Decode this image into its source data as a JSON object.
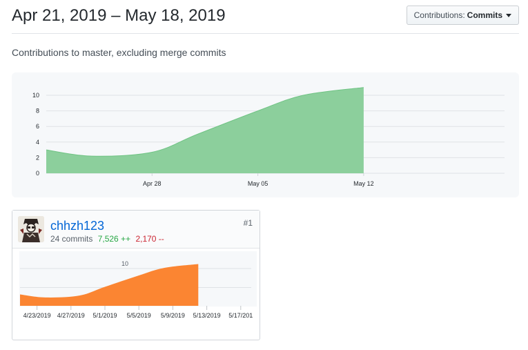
{
  "header": {
    "date_range": "Apr 21, 2019 – May 18, 2019",
    "contributions_select": {
      "label": "Contributions:",
      "value": "Commits"
    }
  },
  "subtitle": "Contributions to master, excluding merge commits",
  "colors": {
    "main_area": "#8ccf9c",
    "main_line": "#6fc383",
    "user_area": "#fb8532",
    "link": "#0366d6",
    "additions": "#28a745",
    "deletions": "#cb2431"
  },
  "chart_data": [
    {
      "type": "area",
      "title": "",
      "xlabel": "",
      "ylabel": "",
      "x_ticks": [
        "Apr 28",
        "May 05",
        "May 12"
      ],
      "y_ticks": [
        "0",
        "2",
        "4",
        "6",
        "8",
        "10"
      ],
      "ylim": [
        0,
        12
      ],
      "grid": true,
      "series": [
        {
          "x": [
            "2019-04-21",
            "2019-04-24",
            "2019-04-28",
            "2019-05-01",
            "2019-05-05",
            "2019-05-08",
            "2019-05-12"
          ],
          "values": [
            3,
            2.2,
            2.7,
            5,
            8,
            10,
            11
          ]
        }
      ]
    },
    {
      "type": "area",
      "title": "",
      "xlabel": "",
      "ylabel": "",
      "x_ticks": [
        "4/23/2019",
        "4/27/2019",
        "5/1/2019",
        "5/5/2019",
        "5/9/2019",
        "5/13/2019",
        "5/17/201"
      ],
      "y_ticks": [
        "10"
      ],
      "ylim": [
        0,
        12
      ],
      "grid": true,
      "series": [
        {
          "x": [
            "2019-04-21",
            "2019-04-24",
            "2019-04-28",
            "2019-05-01",
            "2019-05-05",
            "2019-05-08",
            "2019-05-12"
          ],
          "values": [
            3,
            2.2,
            2.7,
            5,
            8,
            10,
            11
          ]
        }
      ]
    }
  ],
  "user": {
    "name": "chhzh123",
    "commits": "24 commits",
    "additions": "7,526 ++",
    "deletions": "2,170 --",
    "rank": "#1",
    "avatar_icon": "user-avatar-icon"
  }
}
